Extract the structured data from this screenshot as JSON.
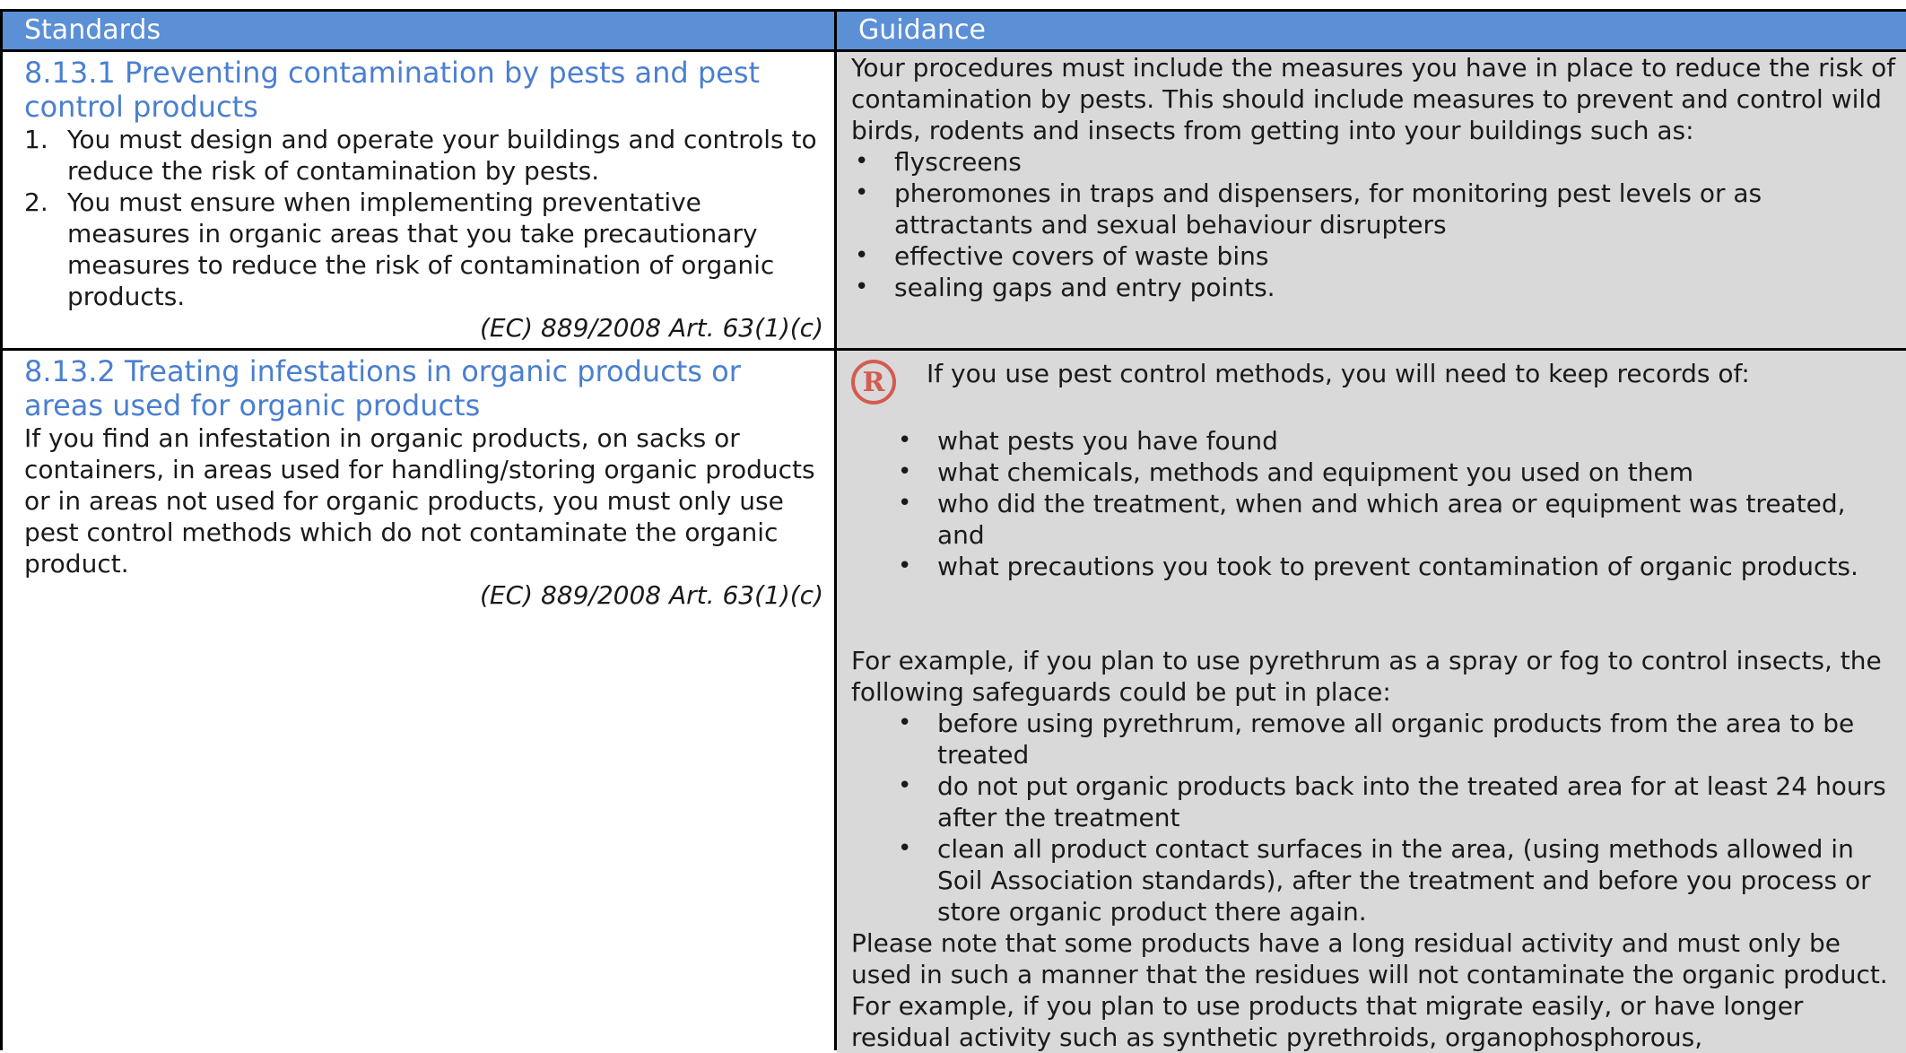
{
  "header": {
    "standards": "Standards",
    "guidance": "Guidance"
  },
  "row1": {
    "title": "8.13.1 Preventing contamination by pests and pest control products",
    "items": [
      {
        "num": "1.",
        "text": "You must design and operate your buildings and controls to reduce the risk of contamination by pests."
      },
      {
        "num": "2.",
        "text": "You must ensure when implementing preventative measures in organic areas that you take precautionary measures to reduce the risk of contamination of organic products."
      }
    ],
    "ref": "(EC) 889/2008 Art. 63(1)(c)",
    "guidance_intro": "Your procedures must include the measures you have in place to reduce the risk of contamination by pests. This should include measures to prevent and control wild birds, rodents and insects from getting into your buildings such as:",
    "guidance_bullets": [
      "flyscreens",
      "pheromones in traps and dispensers, for monitoring pest levels or as attractants and sexual behaviour disrupters",
      "effective covers of waste bins",
      "sealing gaps and entry points."
    ]
  },
  "row2": {
    "title": "8.13.2 Treating infestations in organic products or areas used for organic products",
    "body": "If you find an infestation in organic products, on sacks or containers, in areas used for handling/storing organic products or in areas not used for organic products, you must only use pest control methods which do not contaminate the organic product.",
    "ref": "(EC) 889/2008 Art. 63(1)(c)",
    "record_icon": "R",
    "record_text": "If you use pest control methods, you will need to keep records of:",
    "record_bullets": [
      "what pests you have found",
      "what chemicals, methods and equipment you used on them",
      "who did the treatment, when and which area or equipment was treated, and",
      "what precautions you took to prevent contamination of organic products."
    ],
    "example_intro": "For example, if you plan to use pyrethrum as a spray or fog to control insects, the following safeguards could be put in place:",
    "example_bullets": [
      "before using pyrethrum, remove all organic products from the area to be treated",
      "do not put organic products back into the treated area for at least 24 hours after the treatment",
      "clean all product contact surfaces in the area, (using methods allowed in Soil Association standards), after the treatment and before you process or store organic product there again."
    ],
    "note": "Please note that some products have a long residual activity and must only be used in such a manner that the residues will not contaminate the organic product. For example, if you plan to use products that migrate easily, or have longer residual activity such as synthetic pyrethroids, organophosphorous,"
  },
  "colors": {
    "header_bg": "#5b8fd6",
    "title_text": "#4a7fd0",
    "guidance_bg": "#d9d9d9",
    "record_icon": "#d35b4f"
  }
}
